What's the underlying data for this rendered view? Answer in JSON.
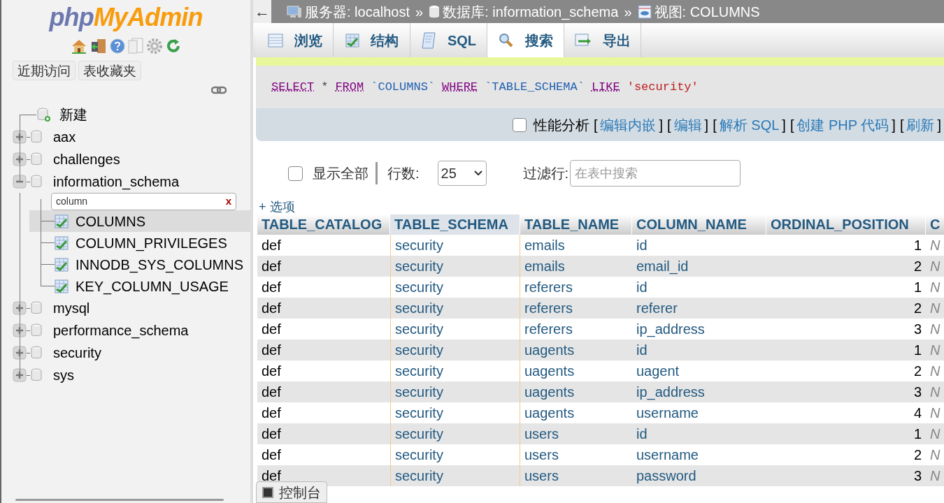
{
  "sidebar": {
    "logo": {
      "php": "php",
      "myadmin": "MyAdmin"
    },
    "tabs": [
      {
        "label": "近期访问"
      },
      {
        "label": "表收藏夹"
      }
    ],
    "tree": [
      {
        "label": "新建",
        "kind": "new"
      },
      {
        "label": "aax",
        "kind": "db",
        "expanded": false
      },
      {
        "label": "challenges",
        "kind": "db",
        "expanded": false
      },
      {
        "label": "information_schema",
        "kind": "db",
        "expanded": true,
        "filter": {
          "value": "column",
          "clear": "x"
        },
        "children": [
          {
            "label": "COLUMNS",
            "selected": true
          },
          {
            "label": "COLUMN_PRIVILEGES",
            "selected": false
          },
          {
            "label": "INNODB_SYS_COLUMNS",
            "selected": false
          },
          {
            "label": "KEY_COLUMN_USAGE",
            "selected": false
          }
        ]
      },
      {
        "label": "mysql",
        "kind": "db",
        "expanded": false
      },
      {
        "label": "performance_schema",
        "kind": "db",
        "expanded": false
      },
      {
        "label": "security",
        "kind": "db",
        "expanded": false
      },
      {
        "label": "sys",
        "kind": "db",
        "expanded": false
      }
    ]
  },
  "breadcrumb": [
    {
      "label": "服务器: localhost",
      "kind": "server"
    },
    {
      "label": "数据库: information_schema",
      "kind": "db"
    },
    {
      "label": "视图: COLUMNS",
      "kind": "view"
    }
  ],
  "breadcrumb_separator": "»",
  "back": "←",
  "tabs": [
    {
      "label": "浏览",
      "kind": "browse",
      "selected": false
    },
    {
      "label": "结构",
      "kind": "structure",
      "selected": false
    },
    {
      "label": "SQL",
      "kind": "sql",
      "selected": false
    },
    {
      "label": "搜索",
      "kind": "search",
      "selected": true
    },
    {
      "label": "导出",
      "kind": "export",
      "selected": false
    }
  ],
  "query": [
    {
      "text": "SELECT",
      "kind": "keyword"
    },
    {
      "text": "*",
      "kind": "op"
    },
    {
      "text": "FROM",
      "kind": "keyword"
    },
    {
      "text": "`COLUMNS`",
      "kind": "ident"
    },
    {
      "text": "WHERE",
      "kind": "keyword"
    },
    {
      "text": "`TABLE_SCHEMA`",
      "kind": "ident"
    },
    {
      "text": "LIKE",
      "kind": "keyword"
    },
    {
      "text": "'security'",
      "kind": "string"
    }
  ],
  "query_tools": {
    "profiling": {
      "label": "性能分析",
      "checked": false
    },
    "bracket_open": "[",
    "bracket_close": "]",
    "links": [
      "编辑内嵌",
      "编辑",
      "解析 SQL",
      "创建 PHP 代码",
      "刷新"
    ]
  },
  "controls": {
    "show_all": {
      "label": "显示全部",
      "checked": false
    },
    "rows_label": "行数:",
    "rows_value": "25",
    "filter_label": "过滤行:",
    "filter_placeholder": "在表中搜索"
  },
  "options_link": "+ 选项",
  "table": {
    "columns": [
      {
        "label": "TABLE_CATALOG",
        "highlighted": false
      },
      {
        "label": "TABLE_SCHEMA",
        "highlighted": true
      },
      {
        "label": "TABLE_NAME",
        "highlighted": false
      },
      {
        "label": "COLUMN_NAME",
        "highlighted": false
      },
      {
        "label": "ORDINAL_POSITION",
        "highlighted": false
      },
      {
        "label": "C",
        "highlighted": false
      }
    ],
    "rows": [
      [
        "def",
        "security",
        "emails",
        "id",
        "1",
        "N"
      ],
      [
        "def",
        "security",
        "emails",
        "email_id",
        "2",
        "N"
      ],
      [
        "def",
        "security",
        "referers",
        "id",
        "1",
        "N"
      ],
      [
        "def",
        "security",
        "referers",
        "referer",
        "2",
        "N"
      ],
      [
        "def",
        "security",
        "referers",
        "ip_address",
        "3",
        "N"
      ],
      [
        "def",
        "security",
        "uagents",
        "id",
        "1",
        "N"
      ],
      [
        "def",
        "security",
        "uagents",
        "uagent",
        "2",
        "N"
      ],
      [
        "def",
        "security",
        "uagents",
        "ip_address",
        "3",
        "N"
      ],
      [
        "def",
        "security",
        "uagents",
        "username",
        "4",
        "N"
      ],
      [
        "def",
        "security",
        "users",
        "id",
        "1",
        "N"
      ],
      [
        "def",
        "security",
        "users",
        "username",
        "2",
        "N"
      ],
      [
        "def",
        "security",
        "users",
        "password",
        "3",
        "N"
      ]
    ]
  },
  "console": "控制台"
}
